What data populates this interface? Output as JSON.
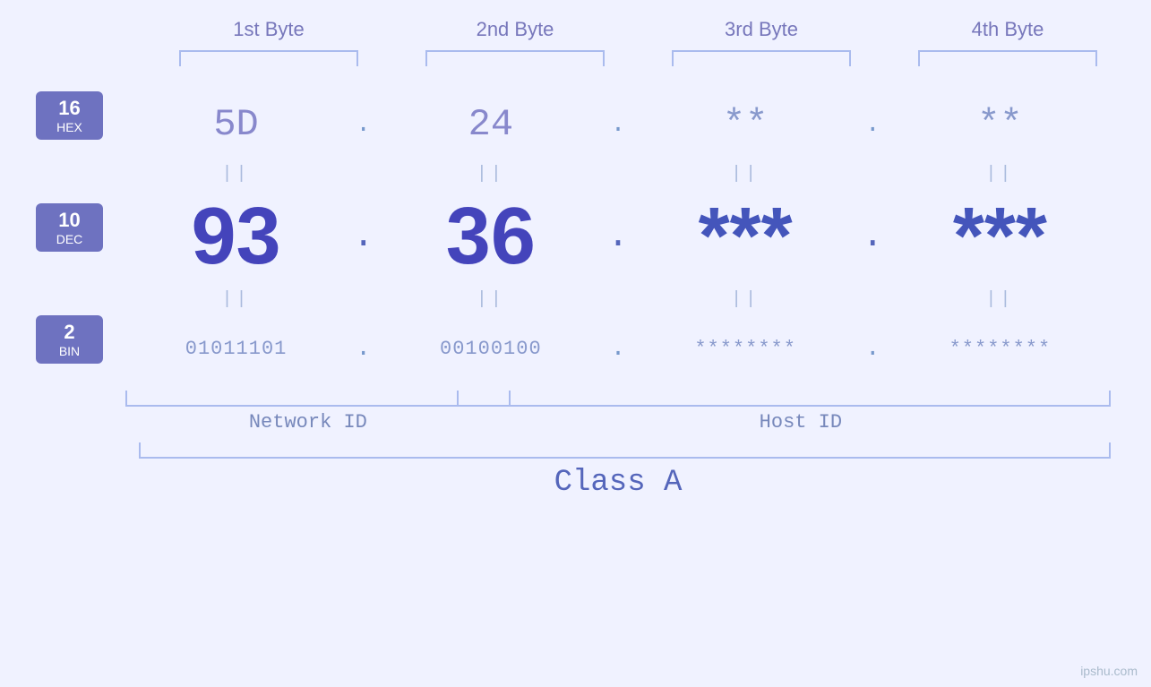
{
  "bytes": {
    "labels": [
      "1st Byte",
      "2nd Byte",
      "3rd Byte",
      "4th Byte"
    ]
  },
  "bases": {
    "hex": {
      "num": "16",
      "label": "HEX"
    },
    "dec": {
      "num": "10",
      "label": "DEC"
    },
    "bin": {
      "num": "2",
      "label": "BIN"
    }
  },
  "values": {
    "hex": [
      "5D",
      "24",
      "**",
      "**"
    ],
    "dec": [
      "93",
      "36",
      "***",
      "***"
    ],
    "bin": [
      "01011101",
      "00100100",
      "********",
      "********"
    ]
  },
  "dots": {
    "hex": ".",
    "dec": ".",
    "bin": "."
  },
  "pipes": "||",
  "labels": {
    "network_id": "Network ID",
    "host_id": "Host ID",
    "class": "Class A"
  },
  "watermark": "ipshu.com"
}
